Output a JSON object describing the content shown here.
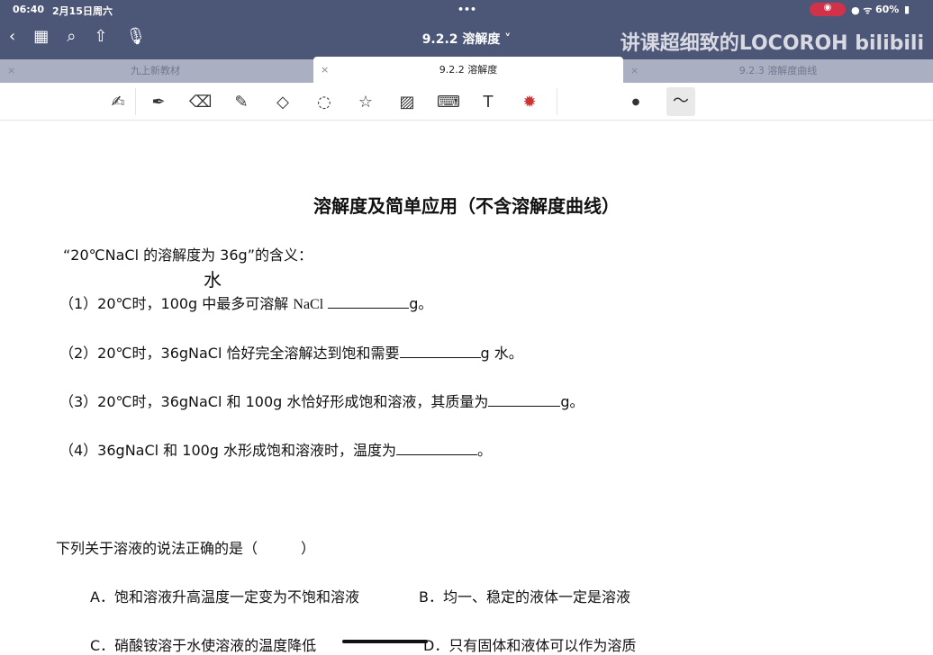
{
  "status": {
    "time": "06:40",
    "date": "2月15日周六",
    "battery": "60%"
  },
  "header": {
    "title": "9.2.2 溶解度 ˅",
    "watermark": "讲课超细致的LOCOROH bilibili"
  },
  "tabs": [
    {
      "label": "九上新教材"
    },
    {
      "label": "9.2.2 溶解度"
    },
    {
      "label": "9.2.3 溶解度曲线"
    }
  ],
  "document": {
    "heading": "溶解度及简单应用（不含溶解度曲线）",
    "intro": "“20℃NaCl 的溶解度为 36g”的含义：",
    "q1a": "（1）20℃时，100g 中最多可溶解",
    "q1b": "NaCl",
    "q1c": "g。",
    "q1hand": "水",
    "q2a": "（2）20℃时，36gNaCl 恰好完全溶解达到饱和需要",
    "q2b": "g 水。",
    "q3a": "（3）20℃时，36gNaCl 和 100g 水恰好形成饱和溶液，其质量为",
    "q3b": "g。",
    "q4a": "（4）36gNaCl 和 100g 水形成饱和溶液时，温度为",
    "q4b": "。",
    "mc_question": "下列关于溶液的说法正确的是（　　　）",
    "optA": "A．饱和溶液升高温度一定变为不饱和溶液",
    "optB": "B．均一、稳定的液体一定是溶液",
    "optC": "C．硝酸铵溶于水使溶液的温度降低",
    "optD": "D．只有固体和液体可以作为溶质"
  }
}
